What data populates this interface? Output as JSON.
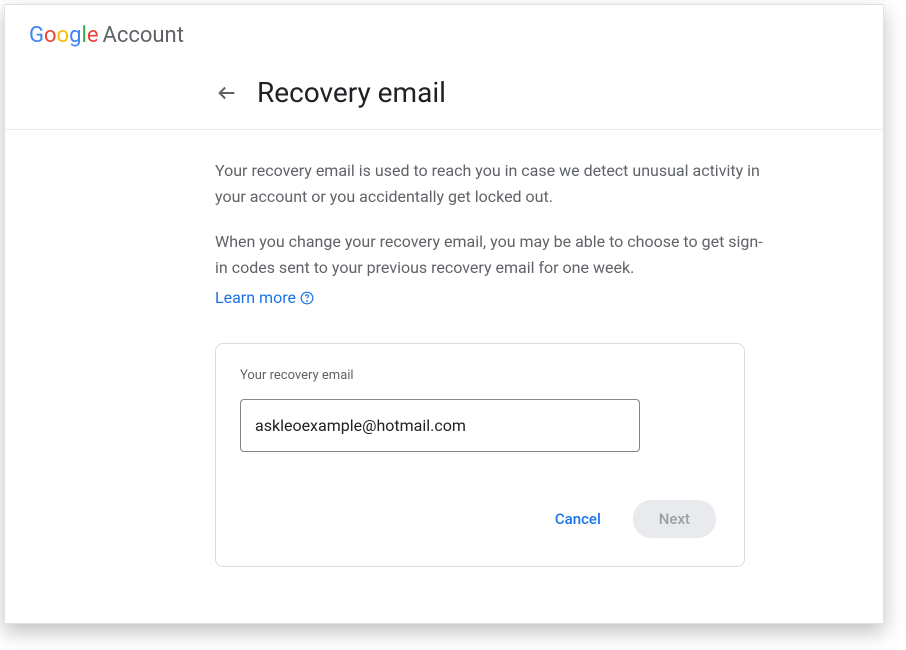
{
  "header": {
    "logo_text": "Google",
    "account_text": "Account"
  },
  "page": {
    "title": "Recovery email",
    "description1": "Your recovery email is used to reach you in case we detect unusual activity in your account or you accidentally get locked out.",
    "description2": "When you change your recovery email, you may be able to choose to get sign-in codes sent to your previous recovery email for one week.",
    "learn_more": "Learn more"
  },
  "form": {
    "label": "Your recovery email",
    "email_value": "askleoexample@hotmail.com",
    "cancel_label": "Cancel",
    "next_label": "Next"
  }
}
